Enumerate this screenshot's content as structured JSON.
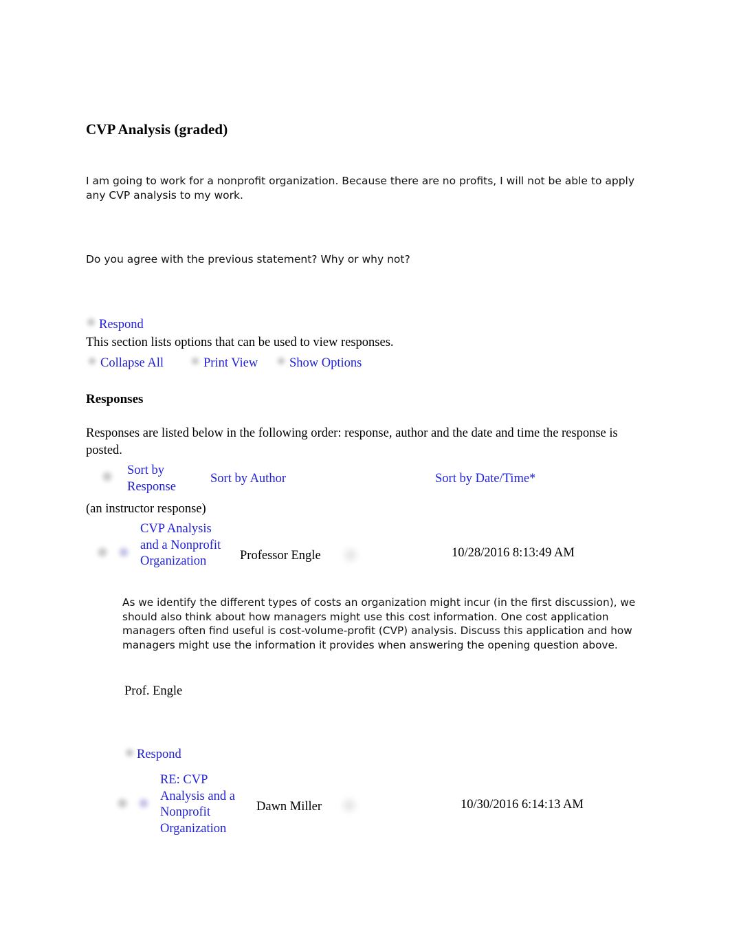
{
  "document": {
    "title": "CVP Analysis (graded)",
    "intro_paragraph": "I am going to work for a nonprofit organization. Because there are no profits, I will not be able to apply any CVP analysis to my work.",
    "question_paragraph": "Do you agree with the previous statement? Why or why not?"
  },
  "options_bar": {
    "respond_label": "Respond",
    "description": "This section lists options that can be used to view responses.",
    "collapse_all_label": "Collapse All",
    "print_view_label": "Print View",
    "show_options_label": "Show Options"
  },
  "responses_section": {
    "heading": "Responses",
    "description": "Responses are listed below in the following order: response, author and the date and time the response is posted.",
    "sort_by_response_label": "Sort by Response",
    "sort_by_author_label": "Sort by Author",
    "sort_by_datetime_label": "Sort by Date/Time*",
    "instructor_note": "(an instructor response)"
  },
  "responses": [
    {
      "subject": "CVP Analysis and a Nonprofit Organization",
      "author": "Professor Engle",
      "datetime": "10/28/2016 8:13:49 AM",
      "body": "As we identify the different types of costs an organization might incur (in the first discussion), we should also think about how managers might use this cost information. One cost application managers often find useful is cost-volume-profit (CVP) analysis. Discuss this application and how managers might use the information it provides when answering the opening question above.",
      "signature": "Prof. Engle",
      "respond_label": "Respond"
    },
    {
      "subject": "RE: CVP Analysis and a Nonprofit Organization",
      "author": "Dawn Miller",
      "datetime": "10/30/2016 6:14:13 AM"
    }
  ],
  "icons": {
    "respond": "respond-icon",
    "collapse_all": "collapse-all-icon",
    "print_view": "print-view-icon",
    "show_options": "show-options-icon",
    "sort": "sort-icon",
    "thread_expand": "thread-expand-icon",
    "thread_message": "thread-message-icon",
    "author_badge": "author-badge-icon"
  },
  "colors": {
    "link": "#2121d6",
    "text": "#000000",
    "background": "#ffffff"
  }
}
